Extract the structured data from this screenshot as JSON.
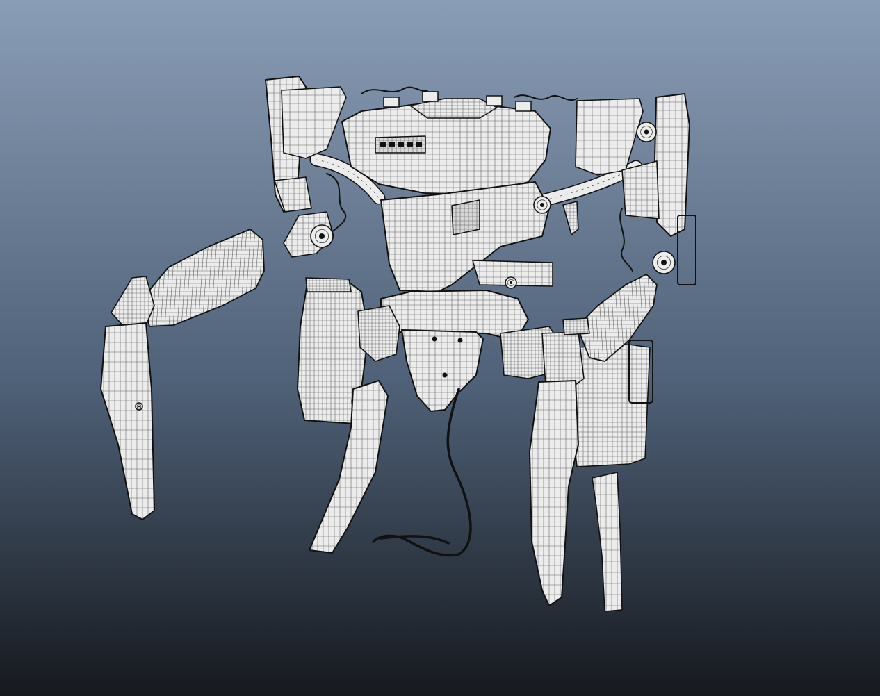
{
  "viewport": {
    "background_top": "#8a9db6",
    "background_mid": "#4f6178",
    "background_bottom": "#16191e"
  },
  "model": {
    "surface_color": "#ececec",
    "wire_color": "#3a3a3a",
    "outline_color": "#111111",
    "cable_color": "#0a0a0a",
    "shadow_color": "#b9bfc6",
    "parts": [
      "head",
      "torso",
      "hip",
      "jaw",
      "shoulder-left",
      "shoulder-right",
      "monitor-left",
      "monitor-right",
      "arm-left",
      "arm-right",
      "hip-pod-left",
      "hip-pod-right",
      "leg-front-left",
      "leg-rear-left",
      "leg-front-right",
      "leg-rear-right",
      "cable"
    ]
  }
}
